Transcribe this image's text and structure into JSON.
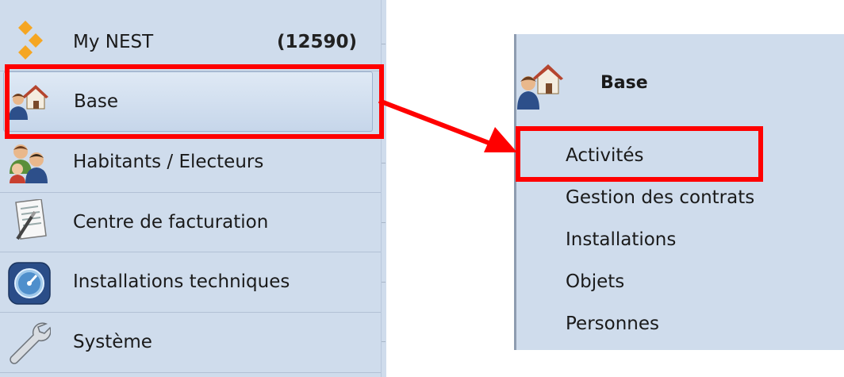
{
  "left_nav": {
    "items": [
      {
        "label": "My NEST",
        "count": "(12590)",
        "icon": "diamond-logo-icon"
      },
      {
        "label": "Base",
        "icon": "house-person-icon",
        "selected": true
      },
      {
        "label": "Habitants / Electeurs",
        "icon": "people-group-icon"
      },
      {
        "label": "Centre de facturation",
        "icon": "document-pen-icon"
      },
      {
        "label": "Installations techniques",
        "icon": "gauge-icon"
      },
      {
        "label": "Système",
        "icon": "wrench-icon"
      }
    ]
  },
  "sub_menu": {
    "title": "Base",
    "icon": "house-person-icon",
    "items": [
      {
        "label": "Activités",
        "highlighted": true
      },
      {
        "label": "Gestion des contrats"
      },
      {
        "label": "Installations"
      },
      {
        "label": "Objets"
      },
      {
        "label": "Personnes"
      }
    ]
  },
  "colors": {
    "panel_bg": "#cfdcec",
    "annotation_red": "#ff0000",
    "logo_orange": "#f5a623"
  }
}
